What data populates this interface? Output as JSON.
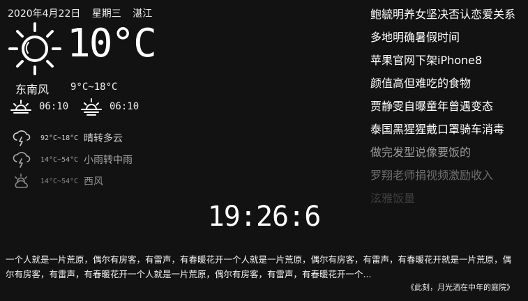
{
  "header": {
    "date": "2020年4月22日",
    "weekday": "星期三",
    "city": "湛江"
  },
  "current": {
    "icon": "sun-icon",
    "temperature": "10°C",
    "wind": "东南风",
    "range": "9°C~18°C",
    "sunrise_time": "06:10",
    "sunset_time": "06:10"
  },
  "forecast": [
    {
      "icon": "thunderstorm-icon",
      "temp": "92°C~18°C",
      "desc": "晴转多云",
      "color": "#d0d0d0"
    },
    {
      "icon": "thunderstorm-icon",
      "temp": "14°C~54°C",
      "desc": "小雨转中雨",
      "color": "#a8a8a8"
    },
    {
      "icon": "partly-cloudy-icon",
      "temp": "14°C~54°C",
      "desc": "西风",
      "color": "#8a8a8a"
    }
  ],
  "news": [
    {
      "title": "鲍毓明养女坚决否认恋爱关系",
      "color": "#ffffff"
    },
    {
      "title": "多地明确暑假时间",
      "color": "#ffffff"
    },
    {
      "title": "苹果官网下架iPhone8",
      "color": "#ffffff"
    },
    {
      "title": "颜值高但难吃的食物",
      "color": "#ffffff"
    },
    {
      "title": "贾静雯自曝童年曾遇变态",
      "color": "#ffffff"
    },
    {
      "title": "泰国黑猩猩戴口罩骑车消毒",
      "color": "#ffffff"
    },
    {
      "title": "做完发型说像要饭的",
      "color": "#9a9a9a"
    },
    {
      "title": "罗翔老师捐视频激励收入",
      "color": "#6e6e6e"
    },
    {
      "title": "泫雅饭量",
      "color": "#3e3e3e"
    }
  ],
  "clock": "19:26:6",
  "quote": {
    "text": "一个人就是一片荒原，偶尔有房客，有雷声，有春暖花开一个人就是一片荒原，偶尔有房客，有雷声，有春暖花开就是一片荒原，偶尔有房客，有雷声，有春暖花开一个人就是一片荒原，偶尔有房客，有雷声，有春暖花开一个...",
    "source": "《此刻，月光洒在中年的庭院》"
  }
}
